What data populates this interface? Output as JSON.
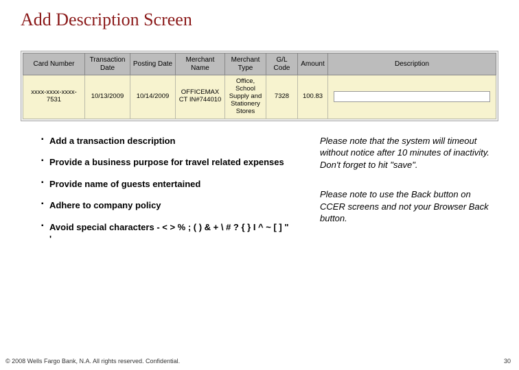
{
  "title": "Add Description Screen",
  "table": {
    "headers": {
      "card": "Card Number",
      "tdate": "Transaction Date",
      "pdate": "Posting Date",
      "mname": "Merchant Name",
      "mtype": "Merchant Type",
      "gl": "G/L Code",
      "amount": "Amount",
      "desc": "Description"
    },
    "row": {
      "card": "xxxx-xxxx-xxxx-7531",
      "tdate": "10/13/2009",
      "pdate": "10/14/2009",
      "mname": "OFFICEMAX CT IN#744010",
      "mtype": "Office, School Supply and Stationery Stores",
      "gl": "7328",
      "amount": "100.83",
      "desc": ""
    }
  },
  "bullets": [
    "Add a transaction description",
    "Provide a business purpose for travel related expenses",
    "Provide name of guests entertained",
    "Adhere to company policy",
    "Avoid special characters - <  > % ; ( ) & + \\ # ? { } I ^ ~ [  ]  \"  '"
  ],
  "notes": [
    "Please note that the system will timeout without notice after 10 minutes of inactivity. Don't forget to hit \"save\".",
    "Please note to use the Back button on CCER screens and not your Browser Back button."
  ],
  "footer": {
    "copyright": "© 2008 Wells Fargo Bank, N.A. All rights reserved. Confidential.",
    "page": "30"
  }
}
